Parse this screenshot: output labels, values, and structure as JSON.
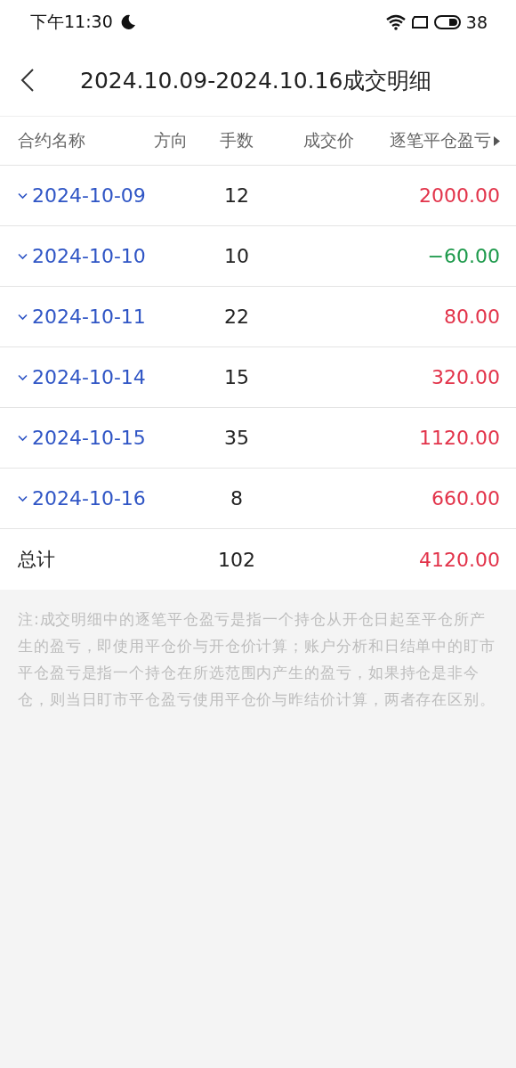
{
  "status_bar": {
    "time": "下午11:30",
    "battery": "38"
  },
  "header": {
    "title": "2024.10.09-2024.10.16成交明细"
  },
  "table": {
    "columns": [
      "合约名称",
      "方向",
      "手数",
      "成交价",
      "逐笔平仓盈亏"
    ],
    "rows": [
      {
        "date": "2024-10-09",
        "quantity": "12",
        "pnl": "2000.00",
        "color": "#e2334a",
        "expanded": false
      },
      {
        "date": "2024-10-10",
        "quantity": "10",
        "pnl": "−60.00",
        "color": "#1e9a4c",
        "expanded": false
      },
      {
        "date": "2024-10-11",
        "quantity": "22",
        "pnl": "80.00",
        "color": "#e2334a",
        "expanded": false
      },
      {
        "date": "2024-10-14",
        "quantity": "15",
        "pnl": "320.00",
        "color": "#e2334a",
        "expanded": false
      },
      {
        "date": "2024-10-15",
        "quantity": "35",
        "pnl": "1120.00",
        "color": "#e2334a",
        "expanded": false
      },
      {
        "date": "2024-10-16",
        "quantity": "8",
        "pnl": "660.00",
        "color": "#e2334a",
        "expanded": false
      }
    ],
    "total": {
      "label": "总计",
      "quantity": "102",
      "pnl": "4120.00",
      "color": "#e2334a"
    }
  },
  "note": "注:成交明细中的逐笔平仓盈亏是指一个持仓从开仓日起至平仓所产生的盈亏，即使用平仓价与开仓价计算；账户分析和日结单中的盯市平仓盈亏是指一个持仓在所选范围内产生的盈亏，如果持仓是非今仓，则当日盯市平仓盈亏使用平仓价与昨结价计算，两者存在区别。"
}
